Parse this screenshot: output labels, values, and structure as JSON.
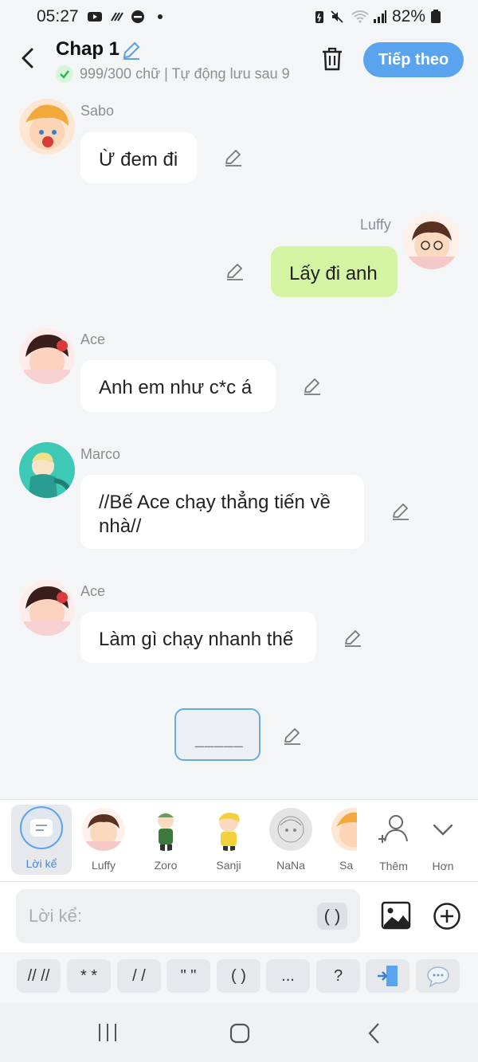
{
  "status": {
    "time": "05:27",
    "battery": "82%"
  },
  "header": {
    "title": "Chap 1",
    "subtitle": "999/300 chữ | Tự động lưu sau 9",
    "next_label": "Tiếp theo"
  },
  "messages": [
    {
      "sender": "Sabo",
      "text": "Ừ đem đi"
    },
    {
      "sender": "Luffy",
      "text": "Lấy đi anh"
    },
    {
      "sender": "Ace",
      "text": "Anh em như c*c á"
    },
    {
      "sender": "Marco",
      "text": "//Bế Ace chạy thẳng tiến về nhà//"
    },
    {
      "sender": "Ace",
      "text": "Làm gì chạy nhanh thế"
    }
  ],
  "placeholder_line": "_____",
  "characters": [
    {
      "label": "Lời kể"
    },
    {
      "label": "Luffy"
    },
    {
      "label": "Zoro"
    },
    {
      "label": "Sanji"
    },
    {
      "label": "NaNa"
    },
    {
      "label": "Sa"
    },
    {
      "label": "Thêm"
    },
    {
      "label": "Hơn"
    }
  ],
  "input": {
    "placeholder": "Lời kể:",
    "paren_label": "( )"
  },
  "symbols": [
    "// //",
    "* *",
    "/ /",
    "\" \"",
    "( )",
    "...",
    "?"
  ],
  "colors": {
    "accent": "#5aa3ee",
    "my_bubble": "#d4f3a3",
    "other_bubble": "#ffffff",
    "background": "#f4f5f7"
  }
}
